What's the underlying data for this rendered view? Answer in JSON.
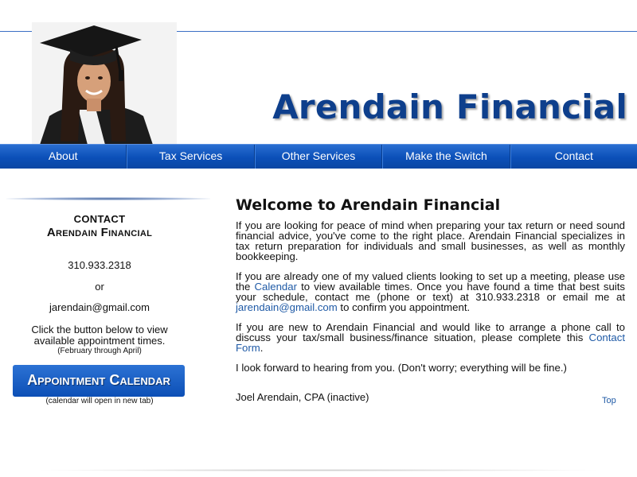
{
  "header": {
    "site_title": "Arendain Financial"
  },
  "nav": {
    "items": [
      "About",
      "Tax Services",
      "Other Services",
      "Make the Switch",
      "Contact"
    ]
  },
  "sidebar": {
    "contact_heading": "CONTACT",
    "contact_name": "Arendain Financial",
    "phone": "310.933.2318",
    "or_text": "or",
    "email": "jarendain@gmail.com",
    "calendar_line1": "Click the button below to view",
    "calendar_line2": "available appointment times.",
    "calendar_range": "(February through April)",
    "appointment_button": "Appointment Calendar",
    "appointment_note": "(calendar will open in new tab)"
  },
  "main": {
    "welcome_title": "Welcome to Arendain Financial",
    "p1": "If you are looking for peace of mind when preparing your tax return or need sound financial advice, you've come to the right place. Arendain Financial specializes in tax return preparation for individuals and small businesses, as well as monthly bookkeeping.",
    "p2_before": "If you are already one of my valued clients looking to set up a meeting, please use the ",
    "p2_link_calendar": "Calendar",
    "p2_middle": " to view available times. Once you have found a time that best suits your schedule, contact me (phone or text) at 310.933.2318 or email me at ",
    "p2_link_email": "jarendain@gmail.com",
    "p2_after": " to confirm you appointment.",
    "p3_before": "If you are new to Arendain Financial and would like to arrange a phone call to discuss your tax/small business/finance situation, please complete this ",
    "p3_link": "Contact Form",
    "p3_after": ".",
    "p4": "I look forward to hearing from you. (Don't worry; everything will be fine.)",
    "signoff": "Joel Arendain, CPA (inactive)"
  },
  "footer": {
    "top_link": "Top"
  },
  "colors": {
    "brand_blue": "#0e3f8c",
    "nav_blue": "#0b4fb8",
    "link_blue": "#1f5aa6"
  }
}
